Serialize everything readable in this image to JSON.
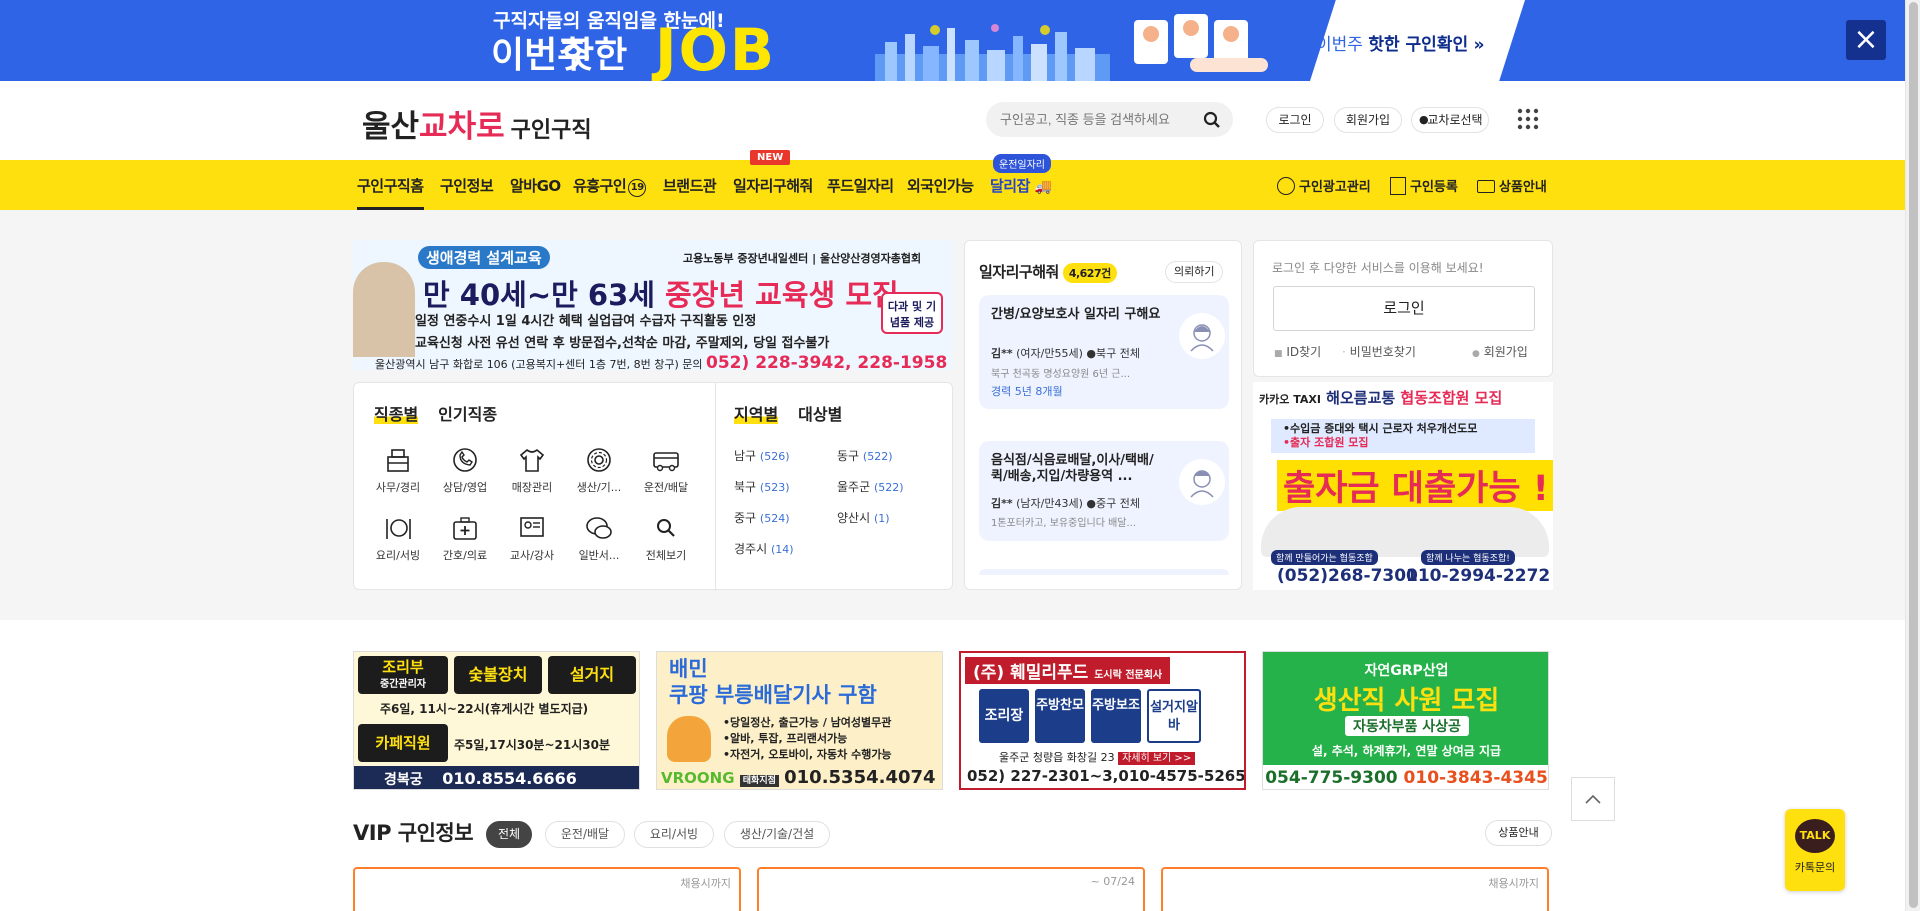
{
  "top_banner": {
    "line1": "구직자들의 움직임을 한눈에!",
    "line2a": "이번주",
    "line2b": "핫한",
    "job": "JOB",
    "cta_a": "이번주",
    "cta_b": "핫한 구인확인",
    "cta_arrow": "»",
    "close": "×"
  },
  "header": {
    "logo_a": "울산",
    "logo_b": "교차로",
    "logo_c": "구인구직",
    "search_placeholder": "구인공고, 직종 등을 검색하세요",
    "login": "로그인",
    "signup": "회원가입",
    "region": "교차로선택"
  },
  "nav": {
    "items": [
      "구인구직홈",
      "구인정보",
      "알바GO",
      "유흥구인",
      "브랜드관",
      "일자리구해줘",
      "푸드일자리",
      "외국인가능",
      "달리잡"
    ],
    "adult_badge": "19",
    "new_tag": "NEW",
    "run_tag": "운전일자리",
    "right": [
      "구인광고관리",
      "구인등록",
      "상품안내"
    ]
  },
  "ad_main": {
    "tag": "생애경력 설계교육",
    "org": "고용노동부 중장년내일센터 | 울산양산경영자총협회",
    "headline_a": "만 40세~만 63세",
    "headline_b": "중장년 교육생 모집",
    "line1": "일정 연중수시 1일 4시간  혜택 실업급여 수급자 구직활동 인정",
    "line2": "교육신청 사전 유선 연락 후 방문접수,선착순 마감, 주말제외, 당일 접수불가",
    "addr": "울산광역시 남구 화합로 106 (고용복지+센터 1층 7번, 8번 창구) 문의",
    "phone": "052) 228-3942, 228-1958",
    "gift": "다과 및 기념품 제공"
  },
  "categories": {
    "tab_job": "직종별",
    "tab_popular": "인기직종",
    "tab_region": "지역별",
    "tab_target": "대상별",
    "icons": [
      {
        "label": "사무/경리",
        "icon": "office-icon"
      },
      {
        "label": "상담/영업",
        "icon": "phone-icon"
      },
      {
        "label": "매장관리",
        "icon": "shirt-icon"
      },
      {
        "label": "생산/기...",
        "icon": "gear-icon"
      },
      {
        "label": "운전/배달",
        "icon": "truck-icon"
      },
      {
        "label": "요리/서빙",
        "icon": "dish-icon"
      },
      {
        "label": "간호/의료",
        "icon": "medical-icon"
      },
      {
        "label": "교사/강사",
        "icon": "teacher-icon"
      },
      {
        "label": "일반서...",
        "icon": "chat-icon"
      },
      {
        "label": "전체보기",
        "icon": "search-icon"
      }
    ],
    "regions": [
      {
        "name": "남구",
        "count": "(526)"
      },
      {
        "name": "동구",
        "count": "(522)"
      },
      {
        "name": "북구",
        "count": "(523)"
      },
      {
        "name": "울주군",
        "count": "(522)"
      },
      {
        "name": "중구",
        "count": "(524)"
      },
      {
        "name": "양산시",
        "count": "(1)"
      },
      {
        "name": "경주시",
        "count": "(14)"
      }
    ]
  },
  "jobseek": {
    "title": "일자리구해줘",
    "count": "4,627건",
    "request": "의뢰하기",
    "cards": [
      {
        "title": "간병/요양보호사 일자리 구해요",
        "name": "김**",
        "meta": "(여자/만55세)",
        "loc": "북구 전체",
        "desc": "북구 천곡동 명성요양원 6년 근...",
        "career": "경력 5년 8개월"
      },
      {
        "title": "음식점/식음료배달,이사/택배/퀵/배송,지입/차량용역 ...",
        "name": "김**",
        "meta": "(남자/만43세)",
        "loc": "중구 전체",
        "desc": "1톤포터카고, 보유중입니다 배달..."
      }
    ]
  },
  "login_box": {
    "prompt": "로그인 후 다양한 서비스를 이용해 보세요!",
    "login": "로그인",
    "find_id": "ID찾기",
    "find_pw": "비밀번호찾기",
    "signup": "회원가입"
  },
  "taxi_ad": {
    "head_a": "카카오 TAXI",
    "head_b": "해오름교통",
    "head_c": "협동조합원 모집",
    "sub1": "•수입금 증대와 택시 근로자 처우개선도모",
    "sub2": "•출자 조합원 모집",
    "big": "출자금 대출가능 !",
    "tag1": "함께 만들어가는 협동조합",
    "tag2": "함께 나누는 협동조합!",
    "phone1": "(052)268-7301",
    "phone2": "010-2994-2272"
  },
  "small_ads": [
    {
      "t1": "조리부",
      "t1s": "중간관리자",
      "t2": "숯불장치",
      "t3": "설거지",
      "l1": "주6일, 11시~22시(휴게시간 별도지급)",
      "t4": "카페직원",
      "l2": "주5일,17시30분~21시30분",
      "name": "경복궁",
      "phone": "010.8554.6666"
    },
    {
      "t1": "배민",
      "t2": "쿠팡 부릉배달기사 구함",
      "l1": "•당일정산, 출근가능 / 남여성별무관",
      "l2": "•알바, 투잡, 프리랜서가능",
      "l3": "•자전거, 오토바이, 자동차 수행가능",
      "brand": "VROONG",
      "sub": "태화지점",
      "phone": "010.5354.4074"
    },
    {
      "t1": "(주) 훼밀리푸드",
      "t1s": "도시락 전문회사",
      "r1": "조리장",
      "r2": "주방찬모",
      "r3": "주방보조",
      "r4": "설거지알바",
      "addr": "울주군 청량읍 화창길 23",
      "more": "자세히 보기 >>",
      "phone": "052) 227-2301~3,010-4575-5265"
    },
    {
      "t1": "자연GRP산업",
      "t2": "생산직 사원 모집",
      "t3": "자동차부품 사상공",
      "l1": "설, 추석, 하계휴가, 연말 상여금 지급",
      "phone1": "054-775-9300",
      "phone2": "010-3843-4345"
    }
  ],
  "vip": {
    "title": "VIP 구인정보",
    "chips": [
      "전체",
      "운전/배달",
      "요리/서빙",
      "생산/기술/건설"
    ],
    "product_info": "상품안내",
    "cards": [
      {
        "deadline": "채용시까지"
      },
      {
        "deadline": "~ 07/24"
      },
      {
        "deadline": "채용시까지"
      }
    ]
  },
  "talk": {
    "bubble": "TALK",
    "label": "카톡문의"
  },
  "colors": {
    "brand_yellow": "#ffe00f",
    "banner_blue": "#2f64e6",
    "accent_red": "#e52b56"
  }
}
